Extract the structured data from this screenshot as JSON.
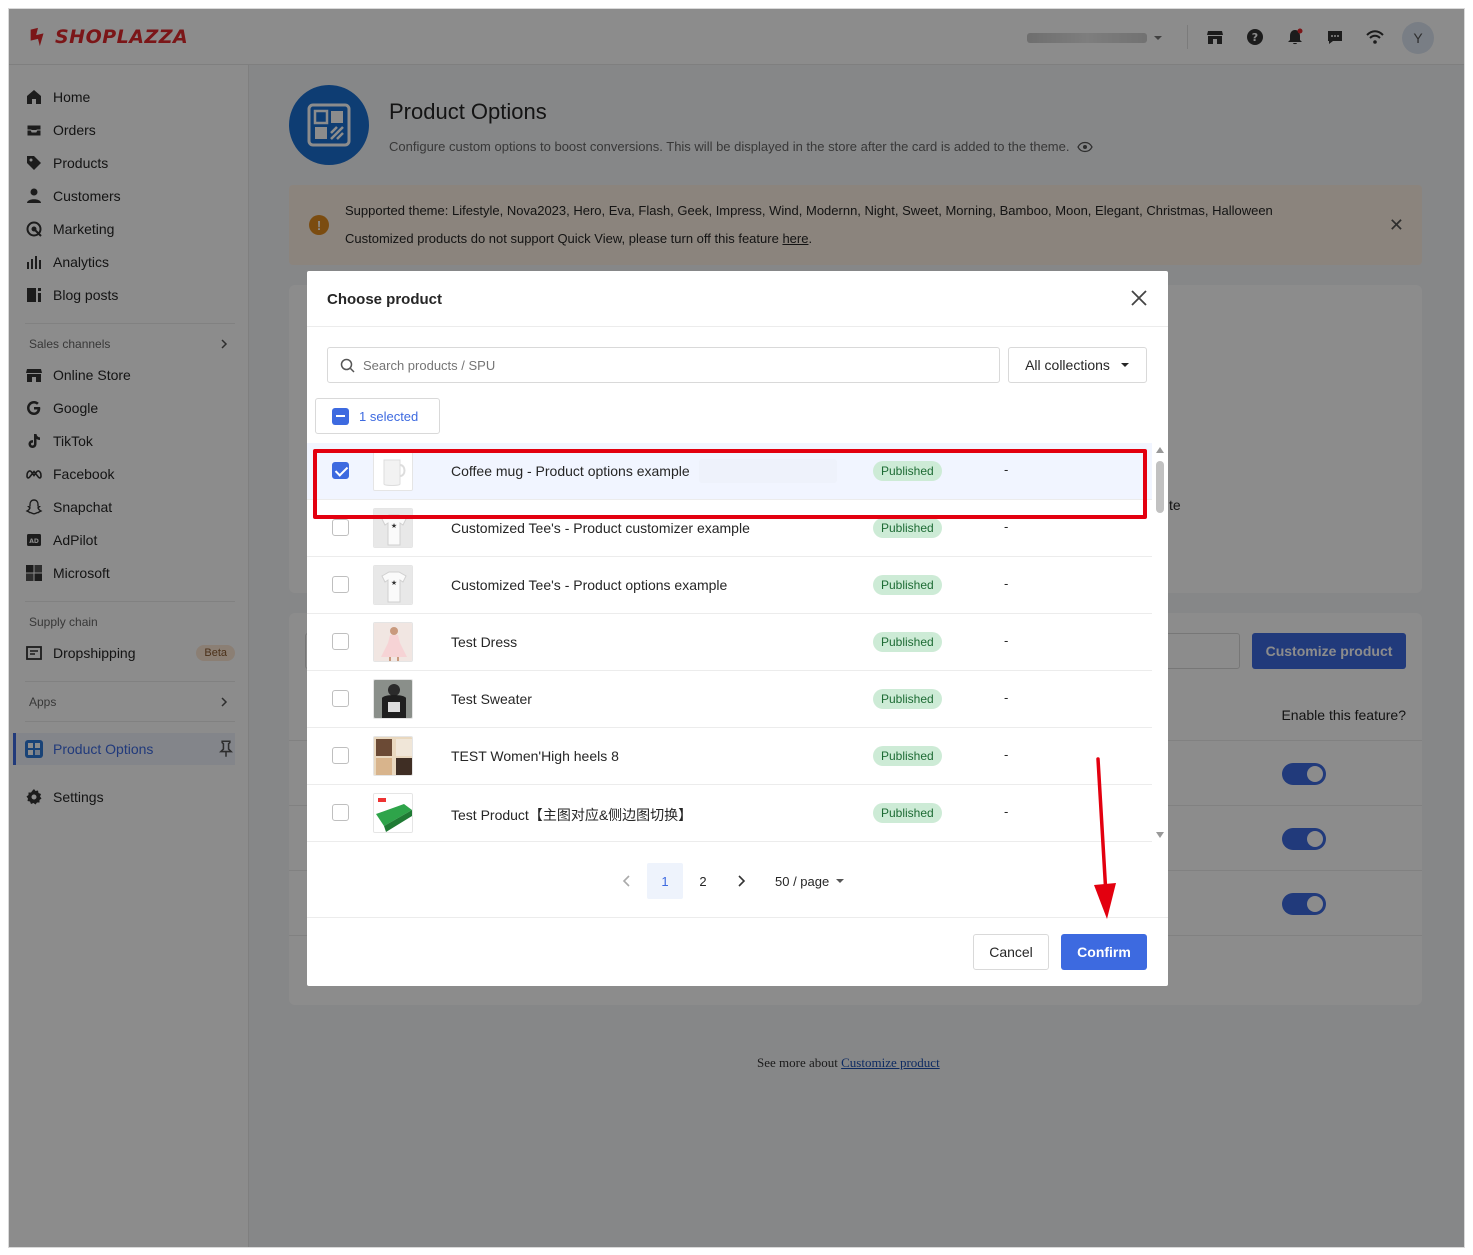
{
  "app": {
    "logo_text": "SHOPLAZZA",
    "avatar_initial": "Y"
  },
  "sidebar": {
    "main_items": [
      {
        "label": "Home"
      },
      {
        "label": "Orders"
      },
      {
        "label": "Products"
      },
      {
        "label": "Customers"
      },
      {
        "label": "Marketing"
      },
      {
        "label": "Analytics"
      },
      {
        "label": "Blog posts"
      }
    ],
    "sales_channels_label": "Sales channels",
    "channels": [
      {
        "label": "Online Store"
      },
      {
        "label": "Google"
      },
      {
        "label": "TikTok"
      },
      {
        "label": "Facebook"
      },
      {
        "label": "Snapchat"
      },
      {
        "label": "AdPilot"
      },
      {
        "label": "Microsoft"
      }
    ],
    "supply_chain_label": "Supply chain",
    "dropshipping": {
      "label": "Dropshipping",
      "badge": "Beta"
    },
    "apps_label": "Apps",
    "active_app": {
      "label": "Product Options"
    },
    "settings": {
      "label": "Settings"
    }
  },
  "page": {
    "title": "Product Options",
    "subtitle": "Configure custom options to boost conversions. This will be displayed in the store after the card is added to the theme.",
    "notice_line1": "Supported theme: Lifestyle, Nova2023, Hero, Eva, Flash, Geek, Impress, Wind, Modernn, Night, Sweet, Morning, Bamboo, Moon, Elegant, Christmas, Halloween",
    "notice_line2_prefix": "Customized products do not support Quick View, please turn off this feature ",
    "notice_line2_link": "here",
    "notice_line2_suffix": ".",
    "customize_button": "Customize product",
    "enable_feature_label": "Enable this feature?",
    "partial_text": "te",
    "see_more_prefix": "See more about ",
    "see_more_link": "Customize product"
  },
  "modal": {
    "title": "Choose product",
    "search_placeholder": "Search products / SPU",
    "collections_label": "All collections",
    "selected_label": "1 selected",
    "products": [
      {
        "name": "Coffee mug - Product options example",
        "status": "Published",
        "extra": "-",
        "checked": true
      },
      {
        "name": "Customized Tee's - Product customizer example",
        "status": "Published",
        "extra": "-",
        "checked": false
      },
      {
        "name": "Customized Tee's - Product options example",
        "status": "Published",
        "extra": "-",
        "checked": false
      },
      {
        "name": "Test Dress",
        "status": "Published",
        "extra": "-",
        "checked": false
      },
      {
        "name": "Test Sweater",
        "status": "Published",
        "extra": "-",
        "checked": false
      },
      {
        "name": "TEST Women'High heels 8",
        "status": "Published",
        "extra": "-",
        "checked": false
      },
      {
        "name": "Test Product【主图对应&侧边图切换】",
        "status": "Published",
        "extra": "-",
        "checked": false
      }
    ],
    "pagination": {
      "current": "1",
      "next_page": "2",
      "page_size": "50 / page"
    },
    "cancel_label": "Cancel",
    "confirm_label": "Confirm"
  },
  "colors": {
    "brand_red": "#e1282d",
    "primary_blue": "#3d6ae0",
    "status_green_bg": "#cdebd6",
    "annotation_red": "#e3000f"
  }
}
